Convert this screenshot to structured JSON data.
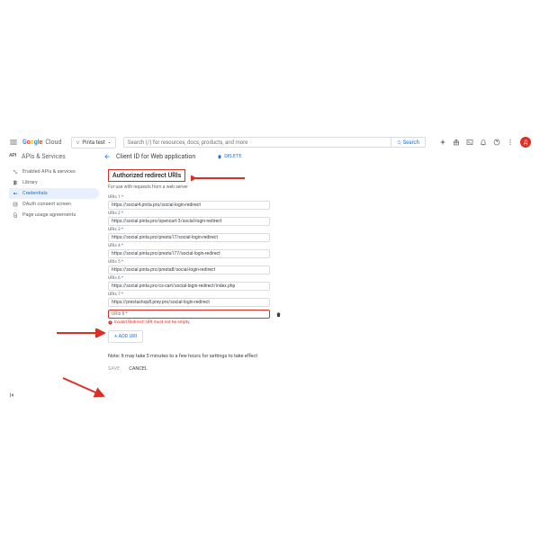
{
  "topbar": {
    "brand_g": "G",
    "brand_o": "o",
    "brand_o2": "o",
    "brand_g2": "g",
    "brand_l": "l",
    "brand_e": "e",
    "brand_cloud": "Cloud",
    "project": "Pinta test",
    "search_placeholder": "Search (/) for resources, docs, products, and more",
    "search_btn": "Search",
    "avatar": "Д"
  },
  "sidebar": {
    "service_icon": "API",
    "service": "APIs & Services",
    "items": [
      "Enabled APIs & services",
      "Library",
      "Credentials",
      "OAuth consent screen",
      "Page usage agreements"
    ]
  },
  "pane": {
    "title": "Client ID for Web application",
    "delete": "DELETE",
    "section": "Authorized redirect URIs",
    "section_sub": "For use with requests from a web server",
    "uris": [
      {
        "label": "URIs 1 *",
        "value": "https://social4.pinta.pro/social-login-redirect"
      },
      {
        "label": "URIs 2 *",
        "value": "https://social.pinta.pro/opencart-3/social-login-redirect"
      },
      {
        "label": "URIs 3 *",
        "value": "https://social.pinta.pro/presta17/social-login-redirect"
      },
      {
        "label": "URIs 4 *",
        "value": "https://social.pinta.pro/presta177/social-login-redirect"
      },
      {
        "label": "URIs 5 *",
        "value": "https://social.pinta.pro/presta8/social-login-redirect"
      },
      {
        "label": "URIs 6 *",
        "value": "https://social.pinta.pro/cs-cart/social-login-redirect/index.php"
      },
      {
        "label": "URIs 7 *",
        "value": "https://prestashop8.prey.pro/social-login-redirect"
      }
    ],
    "err_label": "URIs 8 *",
    "err_msg": "Invalid Redirect: URI must not be empty.",
    "add_uri": "+ ADD URI",
    "note": "Note: It may take 5 minutes to a few hours for settings to take effect",
    "save": "SAVE",
    "cancel": "CANCEL"
  }
}
